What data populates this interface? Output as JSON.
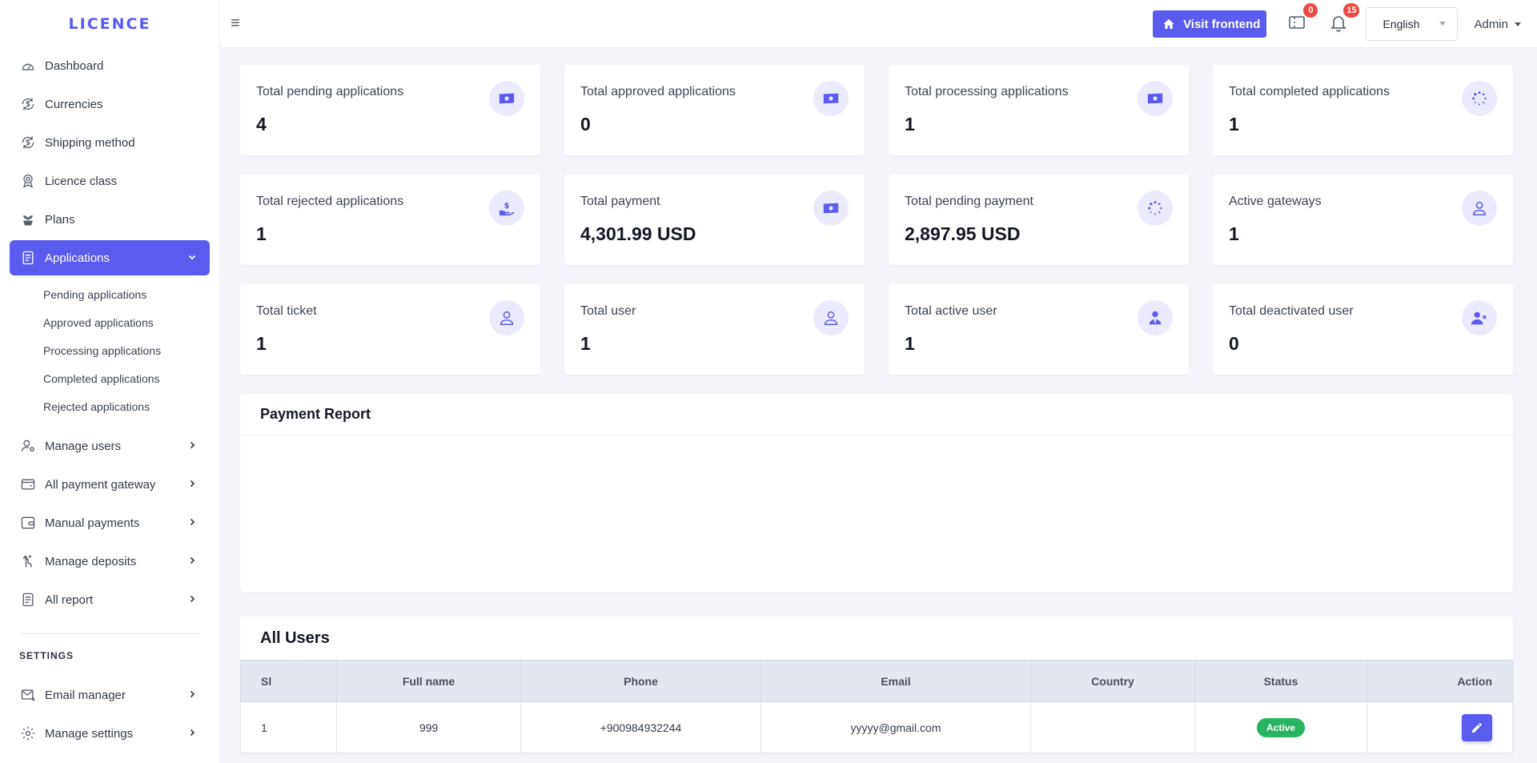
{
  "brand": "LICENCE",
  "sidebar": {
    "items": [
      {
        "label": "Dashboard",
        "icon": "dashboard-icon"
      },
      {
        "label": "Currencies",
        "icon": "currency-icon"
      },
      {
        "label": "Shipping method",
        "icon": "shipping-icon"
      },
      {
        "label": "Licence class",
        "icon": "award-icon"
      },
      {
        "label": "Plans",
        "icon": "plant-icon"
      },
      {
        "label": "Applications",
        "icon": "document-icon"
      }
    ],
    "applications_sub": [
      "Pending applications",
      "Approved applications",
      "Processing applications",
      "Completed applications",
      "Rejected applications"
    ],
    "more": [
      {
        "label": "Manage users",
        "icon": "user-gear-icon"
      },
      {
        "label": "All payment gateway",
        "icon": "wallet-icon"
      },
      {
        "label": "Manual payments",
        "icon": "card-icon"
      },
      {
        "label": "Manage deposits",
        "icon": "deposit-icon"
      },
      {
        "label": "All report",
        "icon": "report-icon"
      }
    ],
    "settings_title": "SETTINGS",
    "settings": [
      {
        "label": "Email manager",
        "icon": "mail-icon"
      },
      {
        "label": "Manage settings",
        "icon": "settings-icon"
      }
    ]
  },
  "topbar": {
    "visit_label": "Visit frontend",
    "ticket_count": "0",
    "notification_count": "15",
    "language": "English",
    "user": "Admin"
  },
  "cards": [
    {
      "label": "Total pending applications",
      "value": "4",
      "icon": "money-icon"
    },
    {
      "label": "Total approved applications",
      "value": "0",
      "icon": "money-icon"
    },
    {
      "label": "Total processing applications",
      "value": "1",
      "icon": "money-icon"
    },
    {
      "label": "Total completed applications",
      "value": "1",
      "icon": "spinner-icon"
    },
    {
      "label": "Total rejected applications",
      "value": "1",
      "icon": "hand-dollar-icon"
    },
    {
      "label": "Total payment",
      "value": "4,301.99 USD",
      "icon": "money-icon"
    },
    {
      "label": "Total pending payment",
      "value": "2,897.95 USD",
      "icon": "spinner-icon"
    },
    {
      "label": "Active gateways",
      "value": "1",
      "icon": "user-icon"
    },
    {
      "label": "Total ticket",
      "value": "1",
      "icon": "user-icon"
    },
    {
      "label": "Total user",
      "value": "1",
      "icon": "user-icon"
    },
    {
      "label": "Total active user",
      "value": "1",
      "icon": "user-tie-icon"
    },
    {
      "label": "Total deactivated user",
      "value": "0",
      "icon": "user-x-icon"
    }
  ],
  "payment_report": {
    "title": "Payment Report"
  },
  "users": {
    "title": "All Users",
    "columns": [
      "Sl",
      "Full name",
      "Phone",
      "Email",
      "Country",
      "Status",
      "Action"
    ],
    "rows": [
      {
        "sl": "1",
        "name": "999",
        "phone": "+900984932244",
        "email": "yyyyy@gmail.com",
        "country": "",
        "status": "Active"
      }
    ]
  },
  "colors": {
    "accent": "#5b5bf0",
    "success": "#28b463",
    "badge": "#ef4a43"
  }
}
